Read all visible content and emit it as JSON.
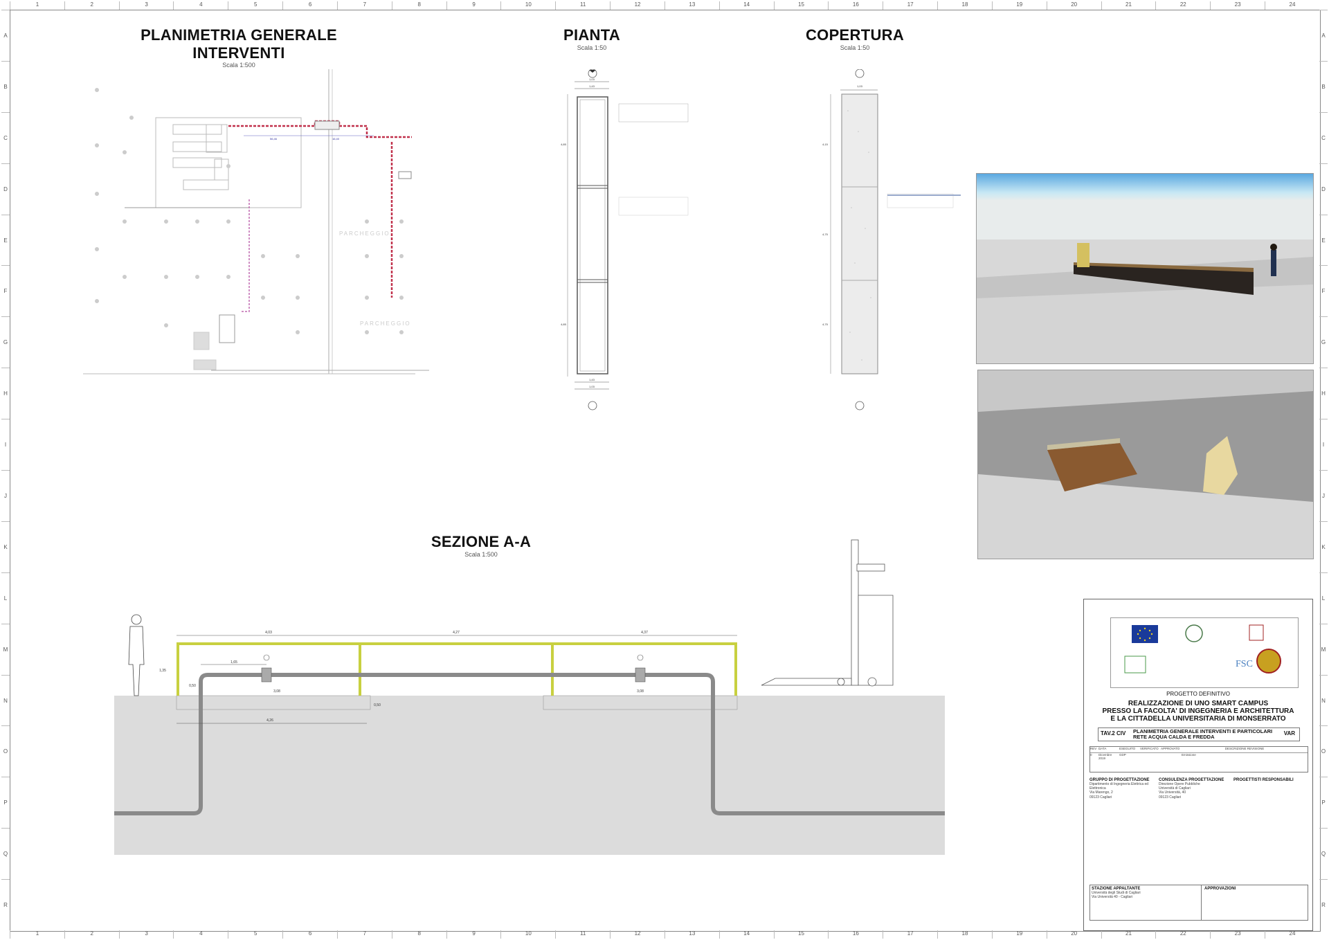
{
  "ruler_columns": [
    "1",
    "2",
    "3",
    "4",
    "5",
    "6",
    "7",
    "8",
    "9",
    "10",
    "11",
    "12",
    "13",
    "14",
    "15",
    "16",
    "17",
    "18",
    "19",
    "20",
    "21",
    "22",
    "23",
    "24"
  ],
  "ruler_rows": [
    "A",
    "B",
    "C",
    "D",
    "E",
    "F",
    "G",
    "H",
    "I",
    "J",
    "K",
    "L",
    "M",
    "N",
    "O",
    "P",
    "Q",
    "R"
  ],
  "views": {
    "plan_general": {
      "title_line1": "PLANIMETRIA GENERALE",
      "title_line2": "INTERVENTI",
      "scale": "Scala 1:500"
    },
    "pianta": {
      "title": "PIANTA",
      "scale": "Scala 1:50",
      "dims": [
        "1,03",
        "1,43",
        "4,85",
        "4,85",
        "1,43",
        "1,03"
      ]
    },
    "copertura": {
      "title": "COPERTURA",
      "scale": "Scala 1:50",
      "dims": [
        "1,03",
        "4,15",
        "4,75",
        "4,75"
      ]
    },
    "sezione": {
      "title": "SEZIONE A-A",
      "scale": "Scala 1:500",
      "dims": [
        "4,03",
        "4,27",
        "4,37",
        "1,65",
        "3,08",
        "3,08",
        "4,26",
        "1,35",
        "0,50",
        "0,50"
      ]
    }
  },
  "plan_labels": {
    "area_label1": "PARCHEGGIO",
    "area_label2": "PARCHEGGIO",
    "dim1": "56,46",
    "dim2": "16,40"
  },
  "titleblock": {
    "logo_eu": "UNIONE EUROPEA",
    "logo_it": "REPUBBLICA ITALIANA",
    "logo_ras": "REGIONE AUTONOMA DELLA SARDEGNA",
    "logo_fsc": "FSC",
    "logo_porter": "PORTER",
    "phase": "PROGETTO DEFINITIVO",
    "project_line1": "REALIZZAZIONE DI UNO SMART CAMPUS",
    "project_line2": "PRESSO LA FACOLTA' DI INGEGNERIA E ARCHITETTURA",
    "project_line3": "E LA CITTADELLA UNIVERSITARIA DI MONSERRATO",
    "tav": "TAV.2 CIV",
    "drawing_title_line1": "PLANIMETRIA GENERALE INTERVENTI  E PARTICOLARI",
    "drawing_title_line2": "RETE ACQUA CALDA E FREDDA",
    "var": "VAR",
    "rev_headers": [
      "REV",
      "DATA",
      "ESEGUITO",
      "VERIFICATO",
      "APPROVATO",
      "DESCRIZIONE REVISIONE"
    ],
    "rev_row": [
      "0",
      "Dicembre 2019",
      "GDP",
      "",
      "",
      "Emissione"
    ],
    "group_title": "GRUPPO DI PROGETTAZIONE",
    "consult_title": "CONSULENZA PROGETTAZIONE",
    "resp_title": "PROGETTISTI RESPONSABILI",
    "group_body": "Dipartimento di Ingegneria Elettrica ed Elettronica\nVia Marengo, 2\n09123 Cagliari",
    "consult_body": "Direzione Opere Pubbliche\nUniversità di Cagliari\nVia Università, 40\n09123 Cagliari",
    "station_title": "STAZIONE APPALTANTE",
    "station_body": "Università degli Studi di Cagliari\nVia Università 40 - Cagliari",
    "approval_title": "APPROVAZIONI"
  },
  "colors": {
    "pipe_red": "#c0304a",
    "pipe_magenta": "#c06ab0",
    "yellow_frame": "#c8d040",
    "ground": "#dcdcdc",
    "pipe_grey": "#8a8a8a"
  }
}
